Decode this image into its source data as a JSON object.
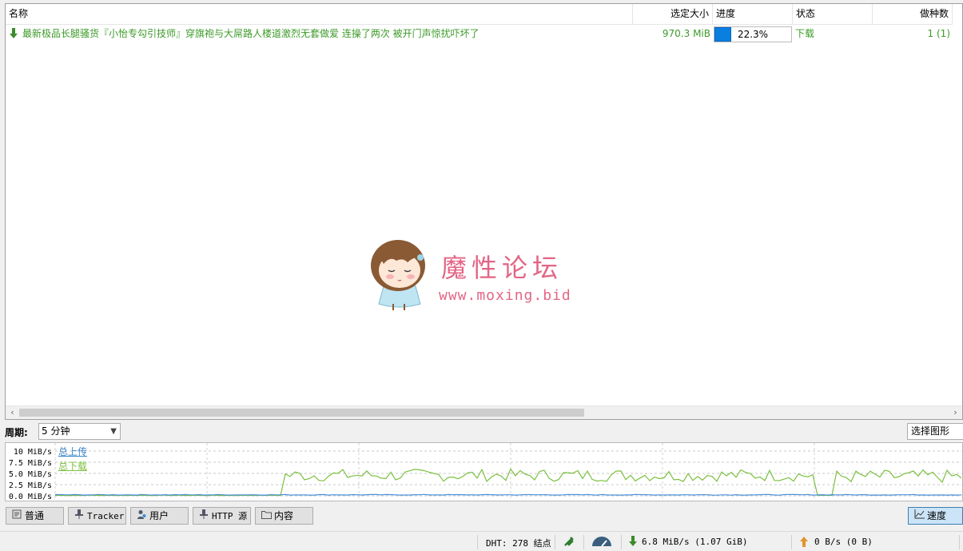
{
  "columns": {
    "name": "名称",
    "size": "选定大小",
    "progress": "进度",
    "status": "状态",
    "seeds": "做种数"
  },
  "torrent": {
    "name": "最新极品长腿骚货『小怡专勾引技师』穿旗袍与大屌路人楼道激烈无套做爱 连操了两次 被开门声惊扰吓坏了",
    "size": "970.3 MiB",
    "progress_text": "22.3%",
    "progress_value": 0.223,
    "status": "下载",
    "seeds": "1 (1)"
  },
  "watermark": {
    "site_name": "魔性论坛",
    "url": "www.moxing.bid"
  },
  "period": {
    "label": "周期:",
    "value": "5 分钟"
  },
  "graph_select": "选择图形",
  "graph": {
    "y_ticks": [
      "10 MiB/s",
      "7.5 MiB/s",
      "5.0 MiB/s",
      "2.5 MiB/s",
      "0.0 MiB/s"
    ],
    "legend_upload": "总上传",
    "legend_download": "总下载",
    "upload_color": "#4a90d9",
    "download_color": "#7cc040"
  },
  "tabs": {
    "general": "普通",
    "tracker": "Tracker",
    "peers": "用户",
    "http": "HTTP 源",
    "content": "内容",
    "speed": "速度"
  },
  "statusbar": {
    "dht": "DHT: 278 结点",
    "download": "6.8 MiB/s (1.07 GiB)",
    "upload": "0 B/s (0 B)"
  },
  "colors": {
    "torrent_text": "#3c9a28",
    "watermark": "#e36586",
    "progress_fill": "#0a7fe0"
  }
}
